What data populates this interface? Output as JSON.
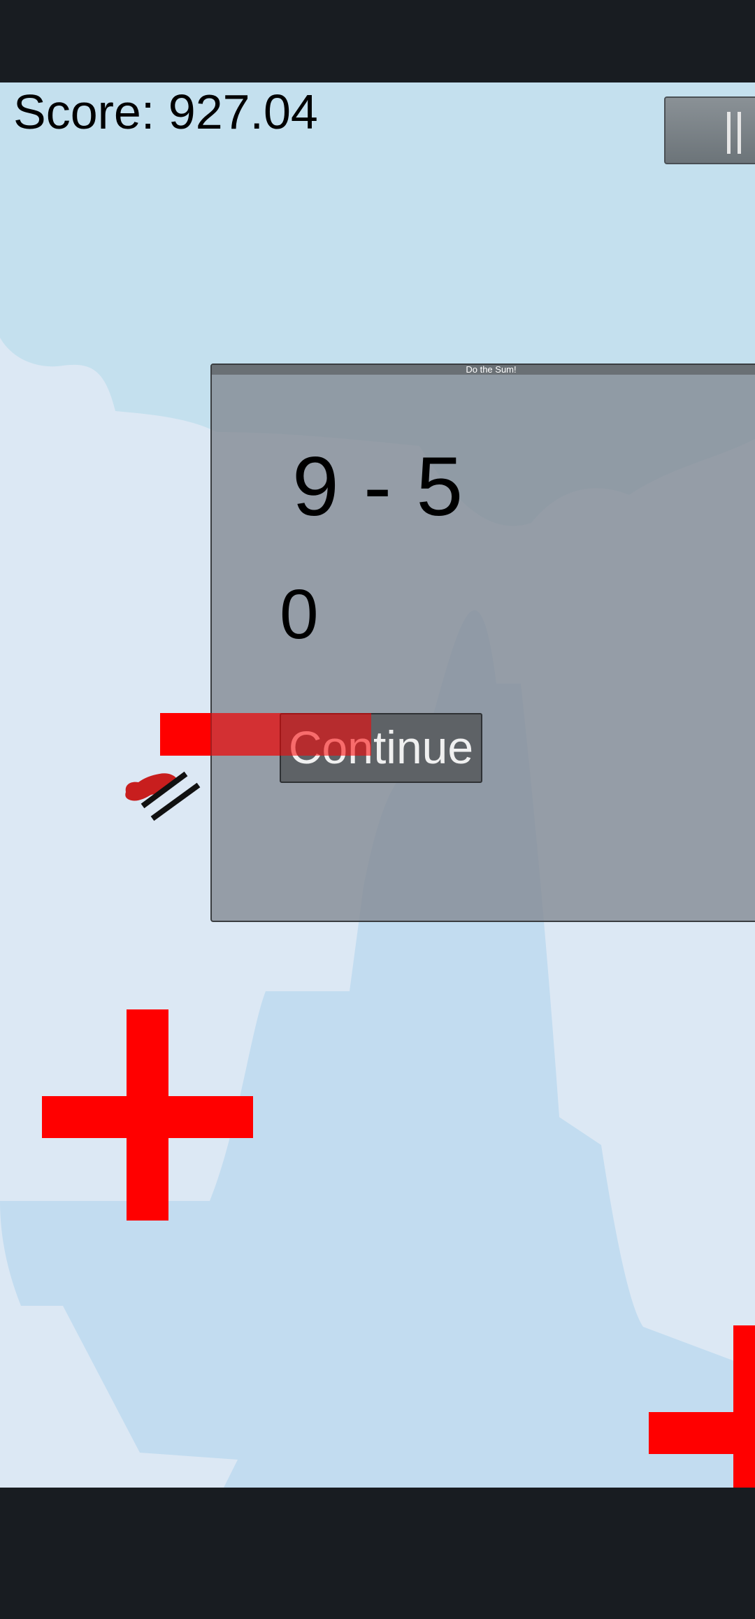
{
  "hud": {
    "score_text": "Score: 927.04"
  },
  "pause_button": {
    "icon": "pause-icon"
  },
  "dialog": {
    "title": "Do the Sum!",
    "equation": "9 - 5",
    "answer": "0",
    "continue_label": "Continue"
  },
  "colors": {
    "sky": "#c4e0ee",
    "cloud": "#dce8f4",
    "mountain": "#c2dcf0",
    "obstacle": "#ff0000",
    "system_bar": "#181c21"
  },
  "icons": {
    "player": "rocket-ship-icon",
    "obstacle": "plus-icon"
  }
}
